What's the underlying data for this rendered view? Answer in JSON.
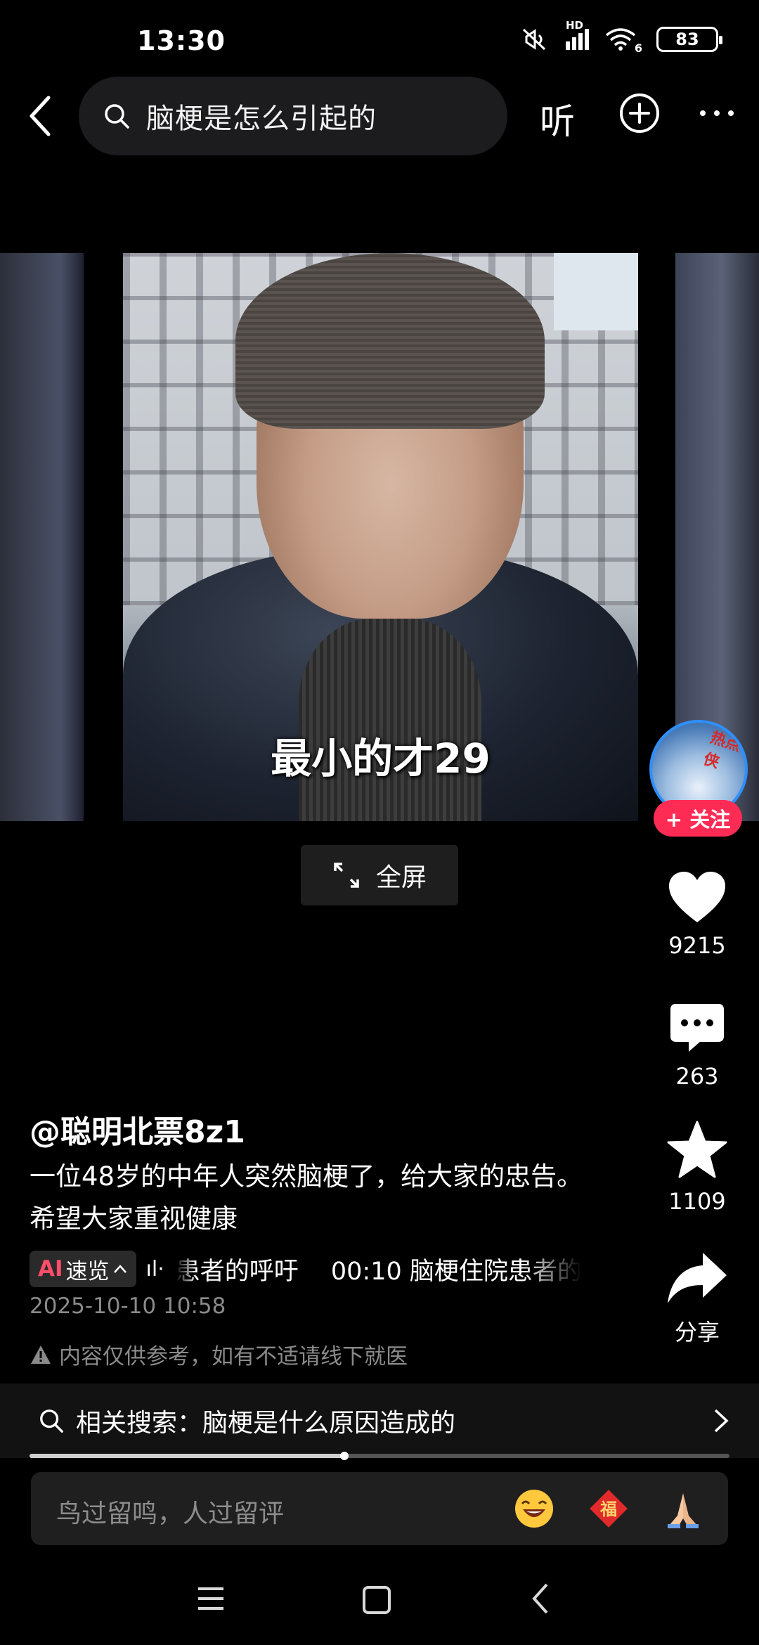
{
  "status_bar": {
    "time": "13:30",
    "network_label": "HD",
    "wifi_label": "6",
    "battery": "83"
  },
  "top_bar": {
    "search_query": "脑梗是怎么引起的",
    "listen_label": "听"
  },
  "video": {
    "subtitle": "最小的才29",
    "fullscreen_label": "全屏"
  },
  "author": {
    "avatar_tag": "热点侠",
    "follow_label": "+ 关注"
  },
  "actions": {
    "likes": "9215",
    "comments": "263",
    "favorites": "1109",
    "share_label": "分享"
  },
  "caption": {
    "author_name": "@聪明北票8z1",
    "description": "一位48岁的中年人突然脑梗了，给大家的忠告。希望大家重视健康",
    "ai_badge_ai": "AI",
    "ai_badge_label": "速览",
    "ai_summary": "患者的呼吁　 00:10 脑梗住院患者的",
    "timestamp": "2025-10-10 10:58",
    "disclaimer": "内容仅供参考，如有不适请线下就医"
  },
  "related": {
    "text": "相关搜索：脑梗是什么原因造成的",
    "progress": 0.45
  },
  "comment": {
    "placeholder": "鸟过留鸣，人过留评",
    "emojis": [
      "laughing-emoji",
      "fu-emoji",
      "pray-emoji"
    ]
  },
  "colors": {
    "accent": "#fe2c55",
    "ai_red": "#ff4d6a",
    "muted": "#8a8a8a"
  }
}
